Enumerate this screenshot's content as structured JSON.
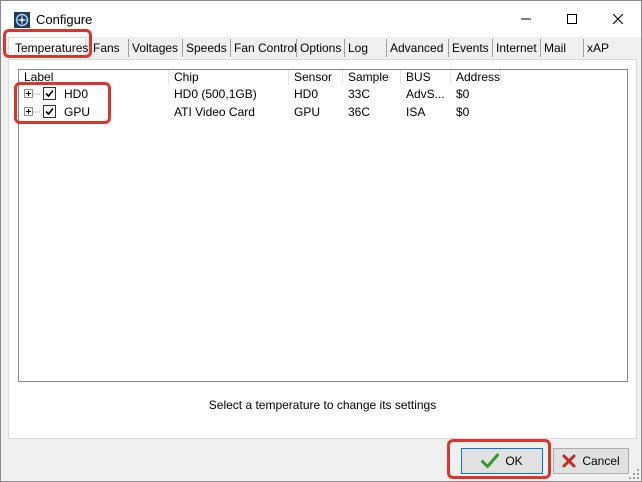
{
  "window": {
    "title": "Configure"
  },
  "tabs": [
    {
      "label": "Temperatures",
      "active": true
    },
    {
      "label": "Fans"
    },
    {
      "label": "Voltages"
    },
    {
      "label": "Speeds"
    },
    {
      "label": "Fan Control"
    },
    {
      "label": "Options"
    },
    {
      "label": "Log"
    },
    {
      "label": "Advanced"
    },
    {
      "label": "Events"
    },
    {
      "label": "Internet"
    },
    {
      "label": "Mail"
    },
    {
      "label": "xAP"
    }
  ],
  "list": {
    "columns": [
      "Label",
      "Chip",
      "Sensor",
      "Sample",
      "BUS",
      "Address"
    ],
    "rows": [
      {
        "checked": true,
        "label": "HD0",
        "chip": "HD0 (500,1GB)",
        "sensor": "HD0",
        "sample": "33C",
        "bus": "AdvS...",
        "address": "$0"
      },
      {
        "checked": true,
        "label": "GPU",
        "chip": "ATI Video Card",
        "sensor": "GPU",
        "sample": "36C",
        "bus": "ISA",
        "address": "$0"
      }
    ]
  },
  "status_text": "Select a temperature to change its settings",
  "buttons": {
    "ok": "OK",
    "cancel": "Cancel"
  },
  "colors": {
    "highlight": "#d9362e",
    "ok_check": "#2e9b2e",
    "cancel_x": "#c42b1c"
  }
}
